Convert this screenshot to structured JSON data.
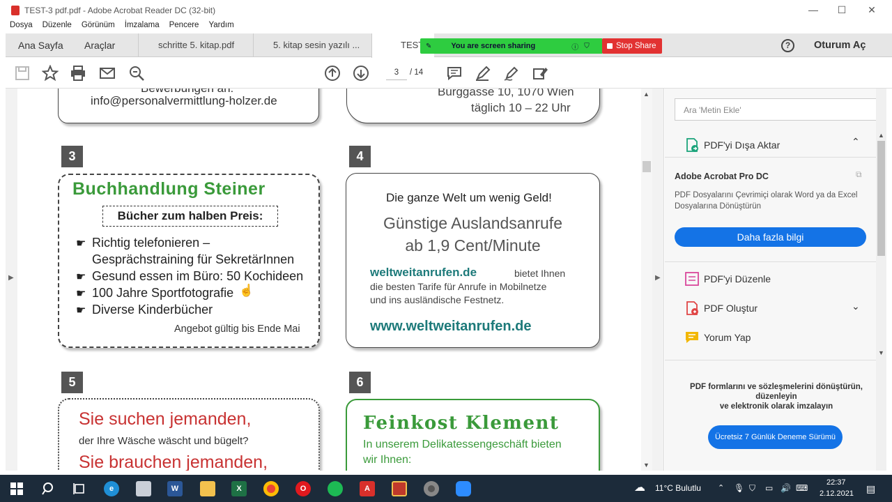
{
  "window": {
    "title": "TEST-3 pdf.pdf - Adobe Acrobat Reader DC (32-bit)",
    "minimize": "—",
    "maximize": "☐",
    "close": "✕"
  },
  "menu": [
    "Dosya",
    "Düzenle",
    "Görünüm",
    "İmzalama",
    "Pencere",
    "Yardım"
  ],
  "tabs": {
    "home": "Ana Sayfa",
    "tools": "Araçlar",
    "doc1": "schritte 5. kitap.pdf",
    "doc2": "5. kitap sesin yazılı ...",
    "doc3": "TEST"
  },
  "share": {
    "message": "You are screen sharing",
    "stop": "Stop Share"
  },
  "signin": "Oturum Aç",
  "pager": {
    "current": "3",
    "total": "/ 14"
  },
  "document": {
    "top_left_partial": "Bewerbungen an:",
    "top_left_email": "info@personalvermittlung-holzer.de",
    "top_right_address": "Burggasse 10, 1070 Wien",
    "top_right_hours": "täglich 10 – 22 Uhr",
    "ad3": {
      "number": "3",
      "title": "Buchhandlung Steiner",
      "subtitle": "Bücher zum halben Preis:",
      "items": [
        "Richtig telefonieren –",
        "Gesprächstraining für SekretärInnen",
        "Gesund essen im Büro: 50 Kochideen",
        "100 Jahre Sportfotografie",
        "Diverse Kinderbücher"
      ],
      "footer": "Angebot gültig bis Ende Mai"
    },
    "ad4": {
      "number": "4",
      "headline": "Die ganze Welt um wenig Geld!",
      "title_line1": "Günstige Auslandsanrufe",
      "title_line2": "ab 1,9 Cent/Minute",
      "brand": "weltweitanrufen.de",
      "body1": "bietet Ihnen",
      "body2": "die besten Tarife für Anrufe in Mobilnetze",
      "body3": "und ins ausländische Festnetz.",
      "url": "www.weltweitanrufen.de"
    },
    "ad5": {
      "number": "5",
      "line1": "Sie suchen jemanden,",
      "line2": "der Ihre Wäsche wäscht und bügelt?",
      "line3": "Sie brauchen jemanden,"
    },
    "ad6": {
      "number": "6",
      "title": "Feinkost Klement",
      "line1": "In unserem Delikatessengeschäft bieten",
      "line2": "wir Ihnen:"
    }
  },
  "panel": {
    "search_placeholder": "Ara 'Metin Ekle'",
    "export": "PDF'yi Dışa Aktar",
    "pro_title": "Adobe Acrobat Pro DC",
    "pro_desc": "PDF Dosyalarını Çevrimiçi olarak Word ya da Excel Dosyalarına Dönüştürün",
    "more_info": "Daha fazla bilgi",
    "edit": "PDF'yi Düzenle",
    "create": "PDF Oluştur",
    "comment": "Yorum Yap",
    "promo_line1": "PDF formlarını ve sözleşmelerini dönüştürün, düzenleyin",
    "promo_line2": "ve elektronik olarak imzalayın",
    "trial": "Ücretsiz 7 Günlük Deneme Sürümü"
  },
  "taskbar": {
    "weather": "11°C  Bulutlu",
    "time": "22:37",
    "date": "2.12.2021"
  },
  "colors": {
    "green": "#3a9a3a",
    "teal": "#1d7a7a",
    "red": "#c83232",
    "adobe_blue": "#1473e6"
  }
}
